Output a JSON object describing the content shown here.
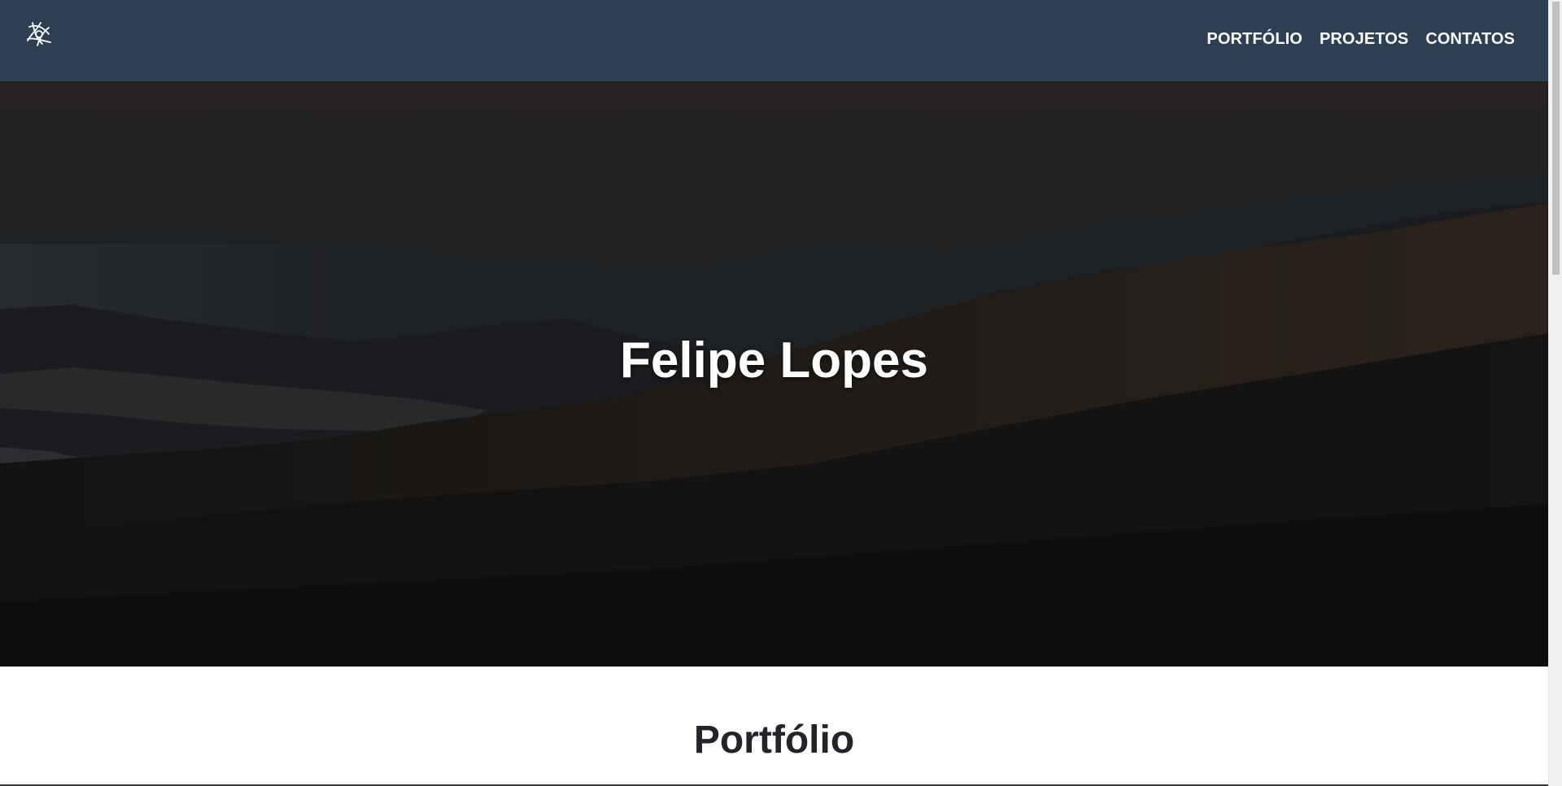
{
  "navbar": {
    "logo_icon": "abstract-star-logo-icon",
    "links": [
      "PORTFÓLIO",
      "PROJETOS",
      "CONTATOS"
    ]
  },
  "hero": {
    "title": "Felipe Lopes",
    "background": "dark-mountain-forest-landscape"
  },
  "portfolio": {
    "title": "Portfólio"
  },
  "colors": {
    "navbar_bg": "#2e3f55",
    "hero_text": "#ffffff",
    "section_title": "#212529"
  }
}
